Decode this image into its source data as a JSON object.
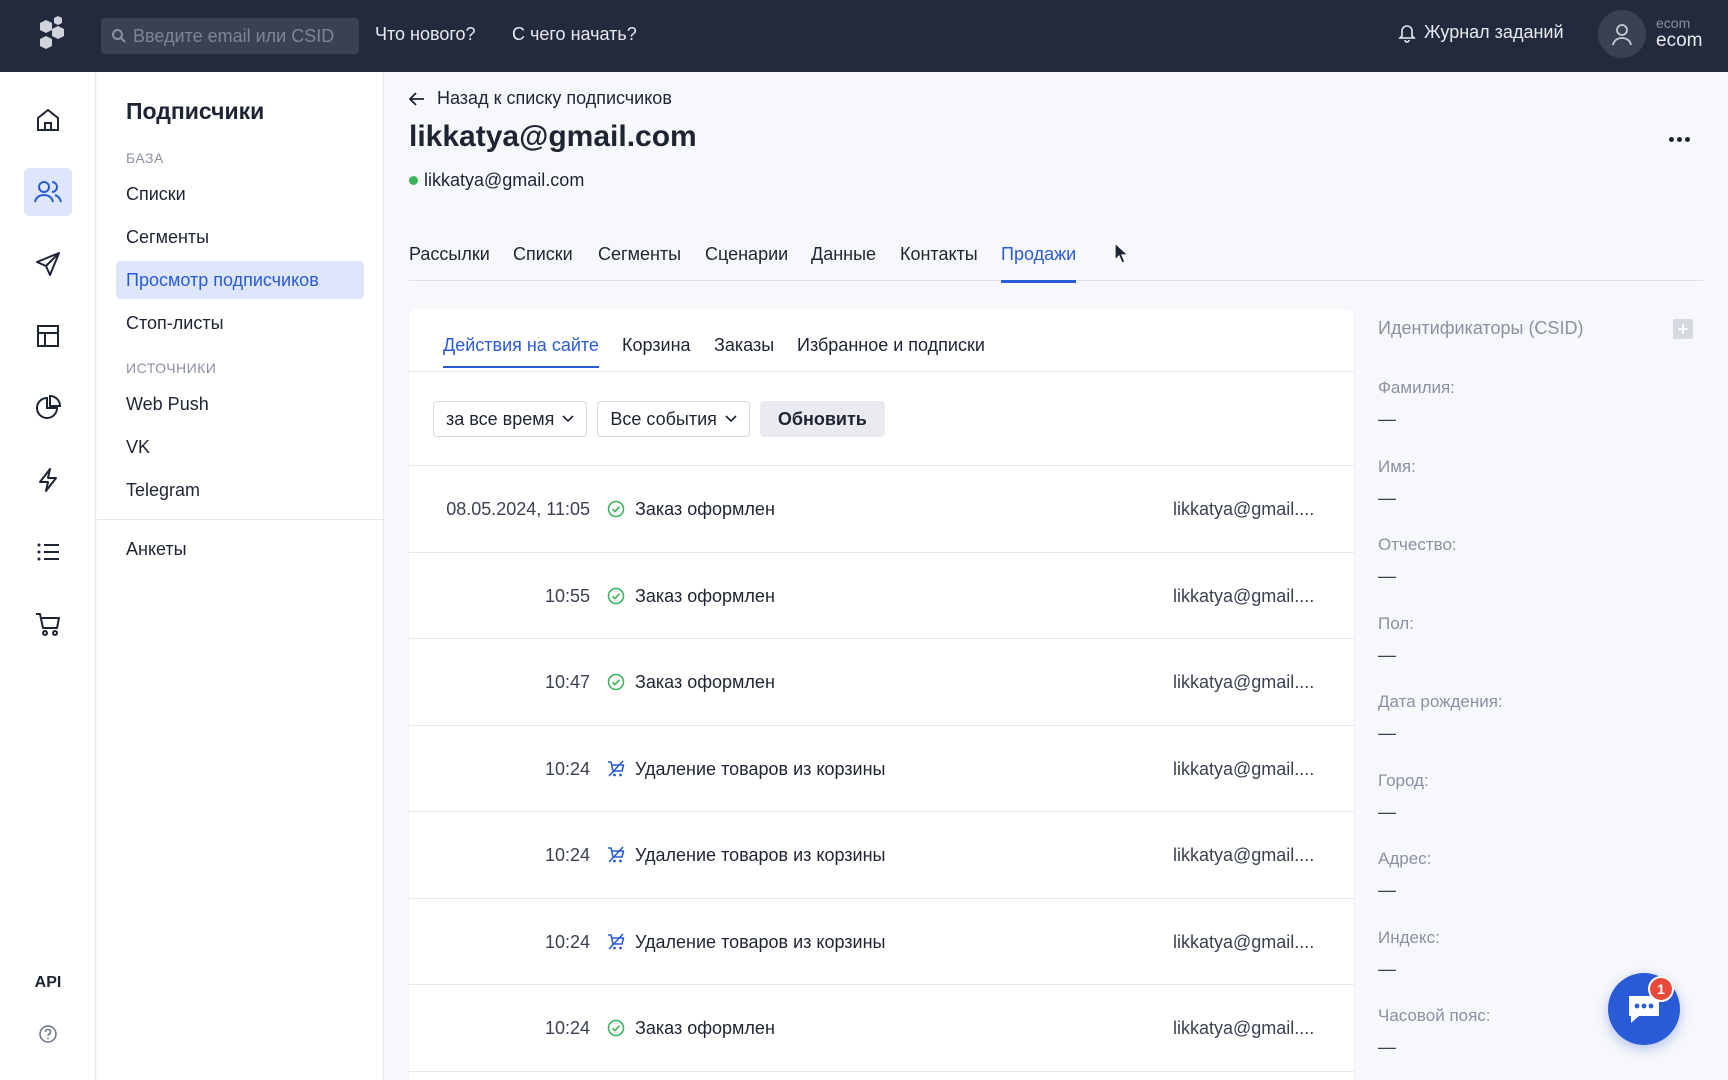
{
  "topbar": {
    "search_placeholder": "Введите email или CSID",
    "links": [
      "Что нового?",
      "С чего начать?"
    ],
    "journal": "Журнал заданий",
    "profile_small": "ecom",
    "profile_big": "ecom"
  },
  "rail": {
    "api": "API"
  },
  "secnav": {
    "title": "Подписчики",
    "group_base": "БАЗА",
    "base_items": [
      "Списки",
      "Сегменты",
      "Просмотр подписчиков",
      "Стоп-листы"
    ],
    "group_sources": "ИСТОЧНИКИ",
    "source_items": [
      "Web Push",
      "VK",
      "Telegram"
    ],
    "extra_item": "Анкеты"
  },
  "main": {
    "back": "Назад к списку подписчиков",
    "title": "likkatya@gmail.com",
    "email": "likkatya@gmail.com",
    "tabs": [
      "Рассылки",
      "Списки",
      "Сегменты",
      "Сценарии",
      "Данные",
      "Контакты",
      "Продажи"
    ],
    "subtabs": [
      "Действия на сайте",
      "Корзина",
      "Заказы",
      "Избранное и подписки"
    ],
    "filter_period": "за все время",
    "filter_events": "Все события",
    "refresh": "Обновить",
    "events": [
      {
        "time": "08.05.2024, 11:05",
        "type": "order",
        "label": "Заказ оформлен",
        "email": "likkatya@gmail...."
      },
      {
        "time": "10:55",
        "type": "order",
        "label": "Заказ оформлен",
        "email": "likkatya@gmail...."
      },
      {
        "time": "10:47",
        "type": "order",
        "label": "Заказ оформлен",
        "email": "likkatya@gmail...."
      },
      {
        "time": "10:24",
        "type": "cart-remove",
        "label": "Удаление товаров из корзины",
        "email": "likkatya@gmail...."
      },
      {
        "time": "10:24",
        "type": "cart-remove",
        "label": "Удаление товаров из корзины",
        "email": "likkatya@gmail...."
      },
      {
        "time": "10:24",
        "type": "cart-remove",
        "label": "Удаление товаров из корзины",
        "email": "likkatya@gmail...."
      },
      {
        "time": "10:24",
        "type": "order",
        "label": "Заказ оформлен",
        "email": "likkatya@gmail...."
      }
    ]
  },
  "rpanel": {
    "head": "Идентификаторы (CSID)",
    "fields": [
      {
        "label": "Фамилия:",
        "value": "—"
      },
      {
        "label": "Имя:",
        "value": "—"
      },
      {
        "label": "Отчество:",
        "value": "—"
      },
      {
        "label": "Пол:",
        "value": "—"
      },
      {
        "label": "Дата рождения:",
        "value": "—"
      },
      {
        "label": "Город:",
        "value": "—"
      },
      {
        "label": "Адрес:",
        "value": "—"
      },
      {
        "label": "Индекс:",
        "value": "—"
      },
      {
        "label": "Часовой пояс:",
        "value": "—"
      }
    ]
  },
  "chat": {
    "badge": "1"
  },
  "colors": {
    "accent": "#2a5bd7",
    "topbar": "#232a3d",
    "success": "#3cb55a",
    "badge": "#ea4a3b"
  }
}
